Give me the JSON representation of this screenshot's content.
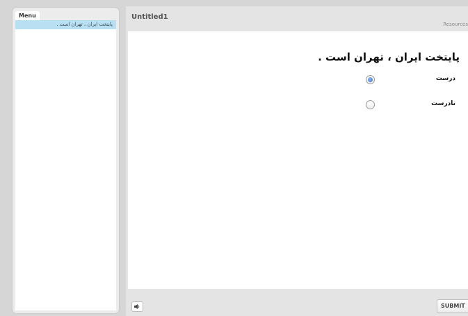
{
  "sidebar": {
    "menu_label": "Menu",
    "items": [
      {
        "label": "پایتخت ایران ، تهران است ."
      }
    ]
  },
  "header": {
    "title": "Untitled1",
    "resources_label": "Resources"
  },
  "question": {
    "text": "پایتخت ایران ، تهران است .",
    "options": [
      {
        "label": "درست",
        "selected": true
      },
      {
        "label": "نادرست",
        "selected": false
      }
    ]
  },
  "footer": {
    "audio_icon": "speaker-icon",
    "submit_label": "SUBMIT"
  },
  "colors": {
    "menu_item_highlight": "#b9dff2",
    "radio_selected": "#3a6fc7"
  }
}
